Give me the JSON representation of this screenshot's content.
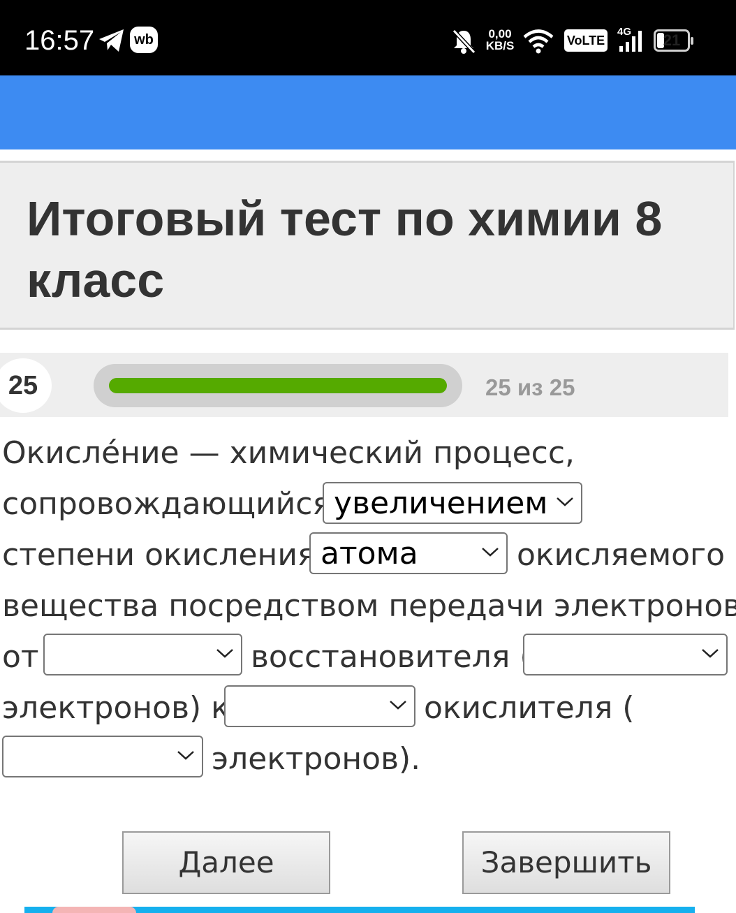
{
  "status_bar": {
    "time": "16:57",
    "app_badge": "wb",
    "net_speed_value": "0,00",
    "net_speed_unit": "KB/S",
    "volte": "VoLTE",
    "network": "4G",
    "battery": "21",
    "icons": [
      "telegram-icon",
      "wildberries-icon",
      "bell-off-icon",
      "wifi-icon",
      "signal-icon",
      "battery-icon"
    ]
  },
  "title": "Итоговый тест по химии 8 класс",
  "progress": {
    "question_number": "25",
    "label": "25 из 25",
    "fraction": 1.0
  },
  "question": {
    "t1": "Окисле́ние — химический процесс,",
    "t2": "сопровождающийся",
    "t3": "степени окисления",
    "t4": "окисляемого",
    "t5": "вещества посредством передачи электронов",
    "t6": "от",
    "t7": "восстановителя (",
    "t8": "электронов) к",
    "t9": "окислителя (",
    "t10": "электронов).",
    "select1": "увеличением",
    "select2": "атома",
    "select3": "",
    "select4": "",
    "select5": "",
    "select6": ""
  },
  "buttons": {
    "next": "Далее",
    "finish": "Завершить"
  },
  "colors": {
    "header_blue": "#3d8bf2",
    "progress_green": "#55aa00",
    "panel_gray": "#eeeeee"
  }
}
